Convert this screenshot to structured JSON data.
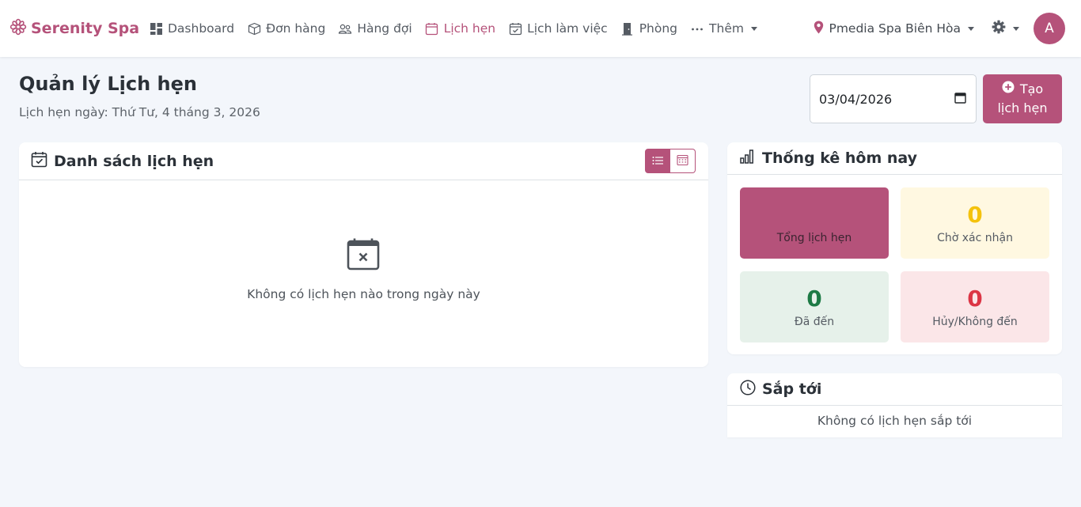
{
  "nav": {
    "brand": "Serenity Spa",
    "items": [
      {
        "label": "Dashboard",
        "icon": "dashboard-icon"
      },
      {
        "label": "Đơn hàng",
        "icon": "box-icon"
      },
      {
        "label": "Hàng đợi",
        "icon": "people-icon"
      },
      {
        "label": "Lịch hẹn",
        "icon": "calendar-icon",
        "active": true
      },
      {
        "label": "Lịch làm việc",
        "icon": "calendar-check-icon"
      },
      {
        "label": "Phòng",
        "icon": "door-icon"
      },
      {
        "label": "Thêm",
        "icon": "more-icon"
      }
    ],
    "location": "Pmedia Spa Biên Hòa",
    "avatar_initial": "A"
  },
  "header": {
    "title": "Quản lý Lịch hẹn",
    "subtitle": "Lịch hẹn ngày: Thứ Tư, 4 tháng 3, 2026",
    "date_value": "03/04/2026",
    "create_button_line1": "Tạo",
    "create_button_line2": "lịch hẹn"
  },
  "appointments": {
    "title": "Danh sách lịch hẹn",
    "empty_text": "Không có lịch hẹn nào trong ngày này"
  },
  "stats": {
    "title": "Thống kê hôm nay",
    "total": {
      "value": "",
      "label": "Tổng lịch hẹn"
    },
    "pending": {
      "value": "0",
      "label": "Chờ xác nhận"
    },
    "arrived": {
      "value": "0",
      "label": "Đã đến"
    },
    "cancelled": {
      "value": "0",
      "label": "Hủy/Không đến"
    }
  },
  "upcoming": {
    "title": "Sắp tới",
    "empty_text": "Không có lịch hẹn sắp tới"
  },
  "colors": {
    "accent": "#b5527a",
    "background": "#f3f6fb"
  }
}
